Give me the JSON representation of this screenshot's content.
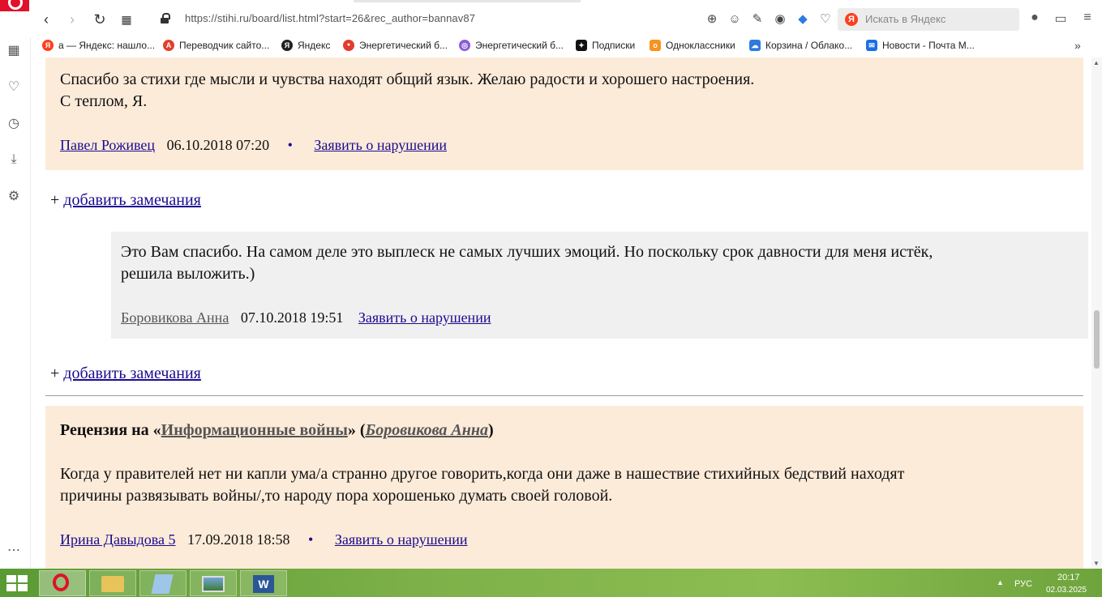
{
  "browser": {
    "url": "https://stihi.ru/board/list.html?start=26&rec_author=bannav87",
    "search_placeholder": "Искать в Яндекс",
    "yandex_letter": "Я",
    "bookmarks": [
      {
        "label": "а — Яндекс: нашло...",
        "icon": "yandex-icon",
        "color": "#fc3f1d",
        "glyph": "Я"
      },
      {
        "label": "Переводчик сайто...",
        "icon": "translator-icon",
        "color": "#e0412b",
        "glyph": "A"
      },
      {
        "label": "Яндекс",
        "icon": "yandex-icon",
        "color": "#222222",
        "glyph": "Я"
      },
      {
        "label": "Энергетический б...",
        "icon": "map-pin-icon",
        "color": "#e33b2e",
        "glyph": "●"
      },
      {
        "label": "Энергетический б...",
        "icon": "globe-icon",
        "color": "#8a5cd6",
        "glyph": "◎"
      },
      {
        "label": "Подписки",
        "icon": "subscriptions-icon",
        "color": "#111111",
        "glyph": "✦"
      },
      {
        "label": "Одноклассники",
        "icon": "ok-icon",
        "color": "#f7931e",
        "glyph": "о"
      },
      {
        "label": "Корзина / Облако...",
        "icon": "cloud-icon",
        "color": "#2b7be0",
        "glyph": "☁"
      },
      {
        "label": "Новости - Почта М...",
        "icon": "mail-icon",
        "color": "#1a6fe0",
        "glyph": "✉"
      }
    ]
  },
  "page": {
    "review1": {
      "text_line1": "Спасибо за стихи где мысли и чувства находят общий язык. Желаю радости и хорошего настроения.",
      "text_line2": "С теплом, Я.",
      "author": "Павел Роживец",
      "date": "06.10.2018 07:20",
      "bullet": "•",
      "report": "Заявить о нарушении"
    },
    "add_remark_plus": "+",
    "add_remark": "добавить замечания",
    "reply1": {
      "text_line1": "Это Вам спасибо. На самом деле это выплеск не самых лучших эмоций. Но поскольку срок давности для меня истёк,",
      "text_line2": "решила выложить.)",
      "author": "Боровикова Анна",
      "date": "07.10.2018 19:51",
      "report": "Заявить о нарушении"
    },
    "review2": {
      "title_prefix": "Рецензия на «",
      "work": "Информационные войны",
      "title_mid": "» (",
      "work_author": "Боровикова Анна",
      "title_suffix": ")",
      "text_line1": "Когда у правителей нет ни капли ума/а странно другое говорить,когда они даже в нашествие стихийных бедствий находят",
      "text_line2": "причины развязывать войны/,то народу пора хорошенько думать своей головой.",
      "author": "Ирина Давыдова 5",
      "date": "17.09.2018 18:58",
      "bullet": "•",
      "report": "Заявить о нарушении"
    }
  },
  "taskbar": {
    "lang": "РУС",
    "time": "20:17",
    "date": "02.03.2025",
    "tray_arrow": "▲"
  },
  "colors": {
    "review_bg": "#fdebd9",
    "reply_bg": "#f0f0f0",
    "link": "#1a0a8f",
    "taskbar": "#7fb14a"
  }
}
